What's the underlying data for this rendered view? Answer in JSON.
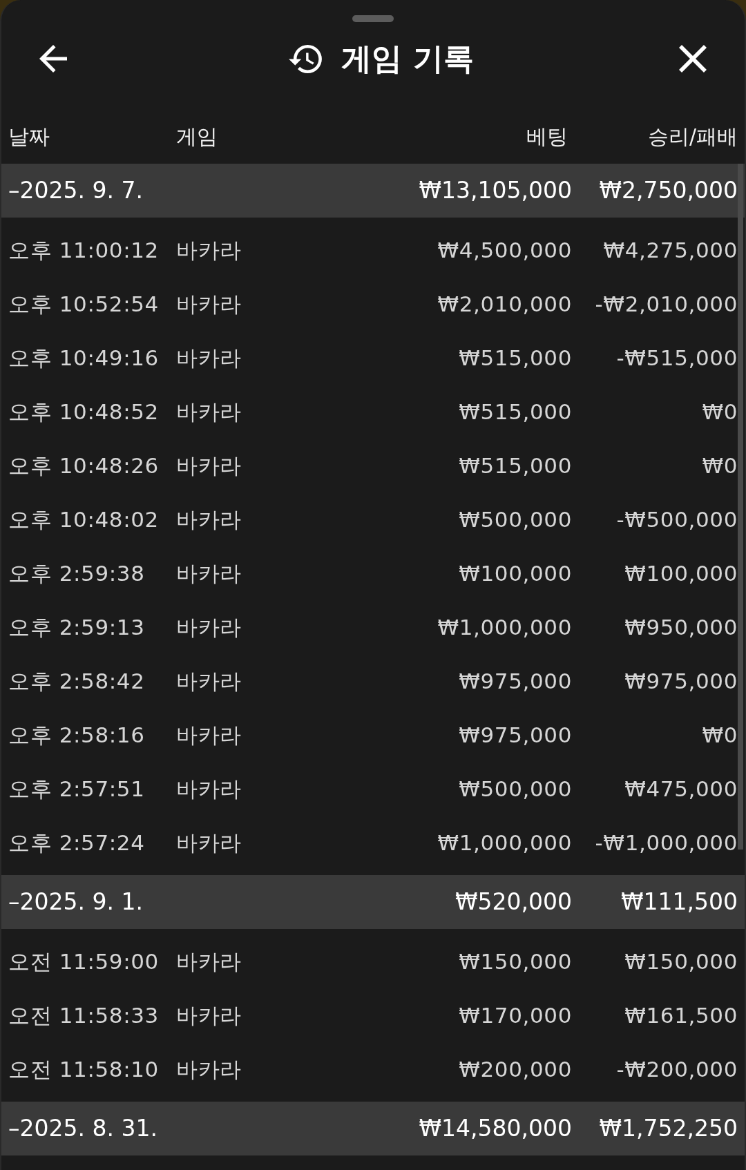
{
  "window": {
    "title": "게임 기록"
  },
  "columns": [
    "날짜",
    "게임",
    "베팅",
    "승리/패배"
  ],
  "groups": [
    {
      "date": "–2025. 9. 7.",
      "bet": "₩13,105,000",
      "result": "₩2,750,000",
      "rows": [
        {
          "time": "오후 11:00:12",
          "game": "바카라",
          "bet": "₩4,500,000",
          "result": "₩4,275,000"
        },
        {
          "time": "오후 10:52:54",
          "game": "바카라",
          "bet": "₩2,010,000",
          "result": "-₩2,010,000"
        },
        {
          "time": "오후 10:49:16",
          "game": "바카라",
          "bet": "₩515,000",
          "result": "-₩515,000"
        },
        {
          "time": "오후 10:48:52",
          "game": "바카라",
          "bet": "₩515,000",
          "result": "₩0"
        },
        {
          "time": "오후 10:48:26",
          "game": "바카라",
          "bet": "₩515,000",
          "result": "₩0"
        },
        {
          "time": "오후 10:48:02",
          "game": "바카라",
          "bet": "₩500,000",
          "result": "-₩500,000"
        },
        {
          "time": "오후 2:59:38",
          "game": "바카라",
          "bet": "₩100,000",
          "result": "₩100,000"
        },
        {
          "time": "오후 2:59:13",
          "game": "바카라",
          "bet": "₩1,000,000",
          "result": "₩950,000"
        },
        {
          "time": "오후 2:58:42",
          "game": "바카라",
          "bet": "₩975,000",
          "result": "₩975,000"
        },
        {
          "time": "오후 2:58:16",
          "game": "바카라",
          "bet": "₩975,000",
          "result": "₩0"
        },
        {
          "time": "오후 2:57:51",
          "game": "바카라",
          "bet": "₩500,000",
          "result": "₩475,000"
        },
        {
          "time": "오후 2:57:24",
          "game": "바카라",
          "bet": "₩1,000,000",
          "result": "-₩1,000,000"
        }
      ]
    },
    {
      "date": "–2025. 9. 1.",
      "bet": "₩520,000",
      "result": "₩111,500",
      "rows": [
        {
          "time": "오전 11:59:00",
          "game": "바카라",
          "bet": "₩150,000",
          "result": "₩150,000"
        },
        {
          "time": "오전 11:58:33",
          "game": "바카라",
          "bet": "₩170,000",
          "result": "₩161,500"
        },
        {
          "time": "오전 11:58:10",
          "game": "바카라",
          "bet": "₩200,000",
          "result": "-₩200,000"
        }
      ]
    },
    {
      "date": "–2025. 8. 31.",
      "bet": "₩14,580,000",
      "result": "₩1,752,250"
    }
  ]
}
